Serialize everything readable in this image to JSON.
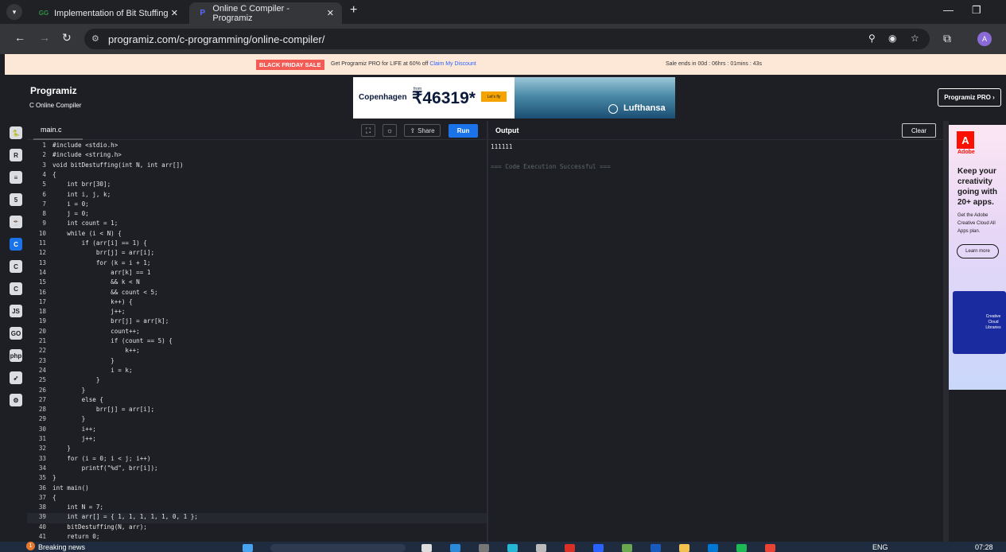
{
  "browser": {
    "tabs": [
      {
        "label": "Implementation of Bit Stuffing",
        "favicon": "GG"
      },
      {
        "label": "Online C Compiler - Programiz",
        "favicon": "P"
      }
    ],
    "url": "programiz.com/c-programming/online-compiler/",
    "profile_initial": "A"
  },
  "promo": {
    "badge": "BLACK FRIDAY SALE",
    "text": "Get Programiz PRO for LIFE at 60% off",
    "link": "Claim My Discount",
    "countdown": "Sale ends in 00d : 06hrs : 01mins : 43s"
  },
  "header": {
    "logo": "Programiz",
    "sublogo": "C Online Compiler",
    "pro_button": "Programiz PRO ›"
  },
  "ad_banner": {
    "city": "Copenhagen",
    "from": "from",
    "price": "₹46319*",
    "cta": "Let's fly",
    "brand": "Lufthansa"
  },
  "editor": {
    "file_tab": "main.c",
    "share_label": "Share",
    "run_label": "Run",
    "highlight_line": 39,
    "lines": [
      "#include <stdio.h>",
      "#include <string.h>",
      "void bitDestuffing(int N, int arr[])",
      "{",
      "    int brr[30];",
      "    int i, j, k;",
      "    i = 0;",
      "    j = 0;",
      "    int count = 1;",
      "    while (i < N) {",
      "        if (arr[i] == 1) {",
      "            brr[j] = arr[i];",
      "            for (k = i + 1;",
      "                arr[k] == 1",
      "                && k < N",
      "                && count < 5;",
      "                k++) {",
      "                j++;",
      "                brr[j] = arr[k];",
      "                count++;",
      "                if (count == 5) {",
      "                    k++;",
      "                }",
      "                i = k;",
      "            }",
      "        }",
      "        else {",
      "            brr[j] = arr[i];",
      "        }",
      "        i++;",
      "        j++;",
      "    }",
      "    for (i = 0; i < j; i++)",
      "        printf(\"%d\", brr[i]);",
      "}",
      "int main()",
      "{",
      "    int N = 7;",
      "    int arr[] = { 1, 1, 1, 1, 1, 0, 1 };",
      "    bitDestuffing(N, arr);",
      "    return 0;"
    ]
  },
  "output": {
    "label": "Output",
    "clear_label": "Clear",
    "result": "111111",
    "status": "=== Code Execution Successful ==="
  },
  "side_ad": {
    "brand": "Adobe",
    "headline": "Keep your creativity going with 20+ apps.",
    "subtext": "Get the Adobe Creative Cloud All Apps plan.",
    "cta": "Learn more",
    "library": "Creative Cloud Libraries"
  },
  "languages": [
    "python",
    "r",
    "sql",
    "html",
    "java",
    "c",
    "cpp",
    "csharp",
    "js",
    "go",
    "php",
    "swift",
    "rust"
  ],
  "taskbar": {
    "news": "Breaking news",
    "news_badge": "1",
    "lang": "ENG",
    "time": "07:28"
  }
}
